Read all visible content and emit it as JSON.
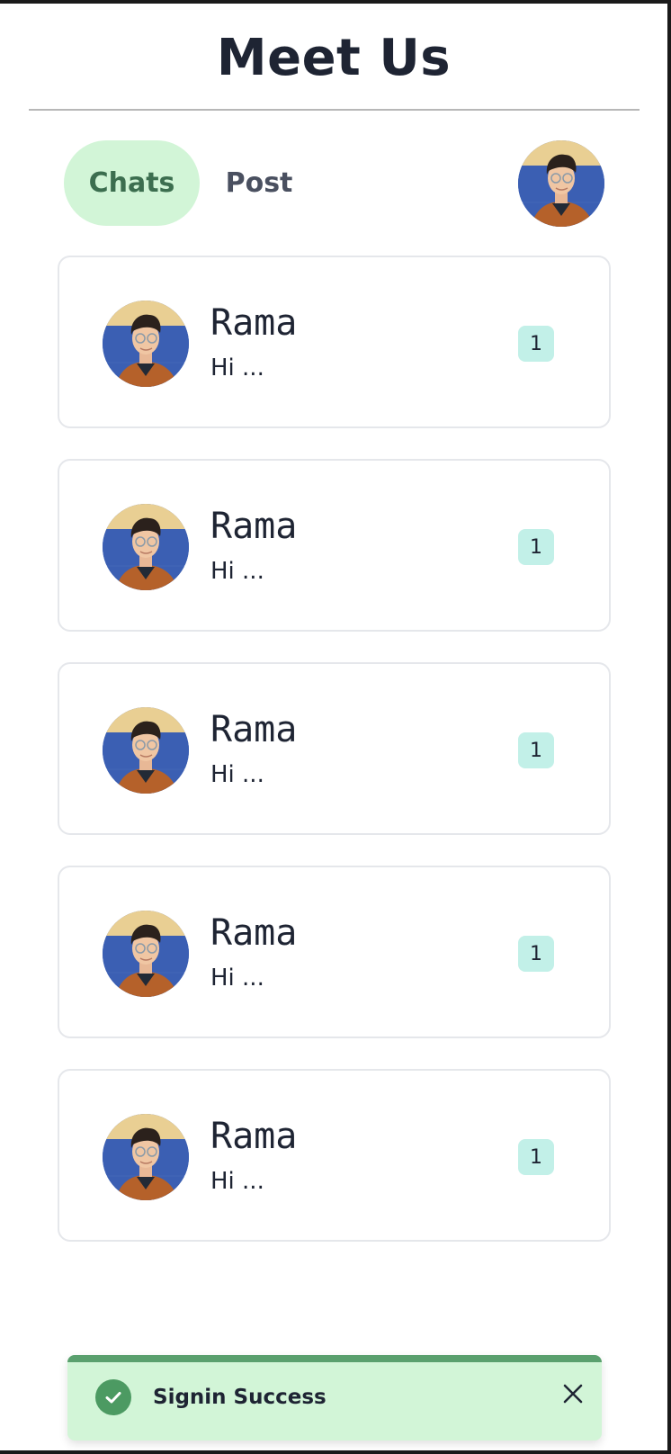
{
  "header": {
    "title": "Meet Us"
  },
  "tabs": [
    {
      "label": "Chats",
      "active": true
    },
    {
      "label": "Post",
      "active": false
    }
  ],
  "chats": [
    {
      "name": "Rama",
      "message": "Hi ...",
      "unread": "1"
    },
    {
      "name": "Rama",
      "message": "Hi ...",
      "unread": "1"
    },
    {
      "name": "Rama",
      "message": "Hi ...",
      "unread": "1"
    },
    {
      "name": "Rama",
      "message": "Hi ...",
      "unread": "1"
    },
    {
      "name": "Rama",
      "message": "Hi ...",
      "unread": "1"
    }
  ],
  "toast": {
    "message": "Signin Success",
    "icon": "check-circle-icon",
    "close_icon": "close-icon"
  },
  "colors": {
    "active_tab_bg": "#d2f5d7",
    "active_tab_text": "#3c6e4f",
    "badge_bg": "#c2f0e8",
    "toast_bg": "#d2f5d7",
    "toast_accent": "#5aa06e"
  }
}
